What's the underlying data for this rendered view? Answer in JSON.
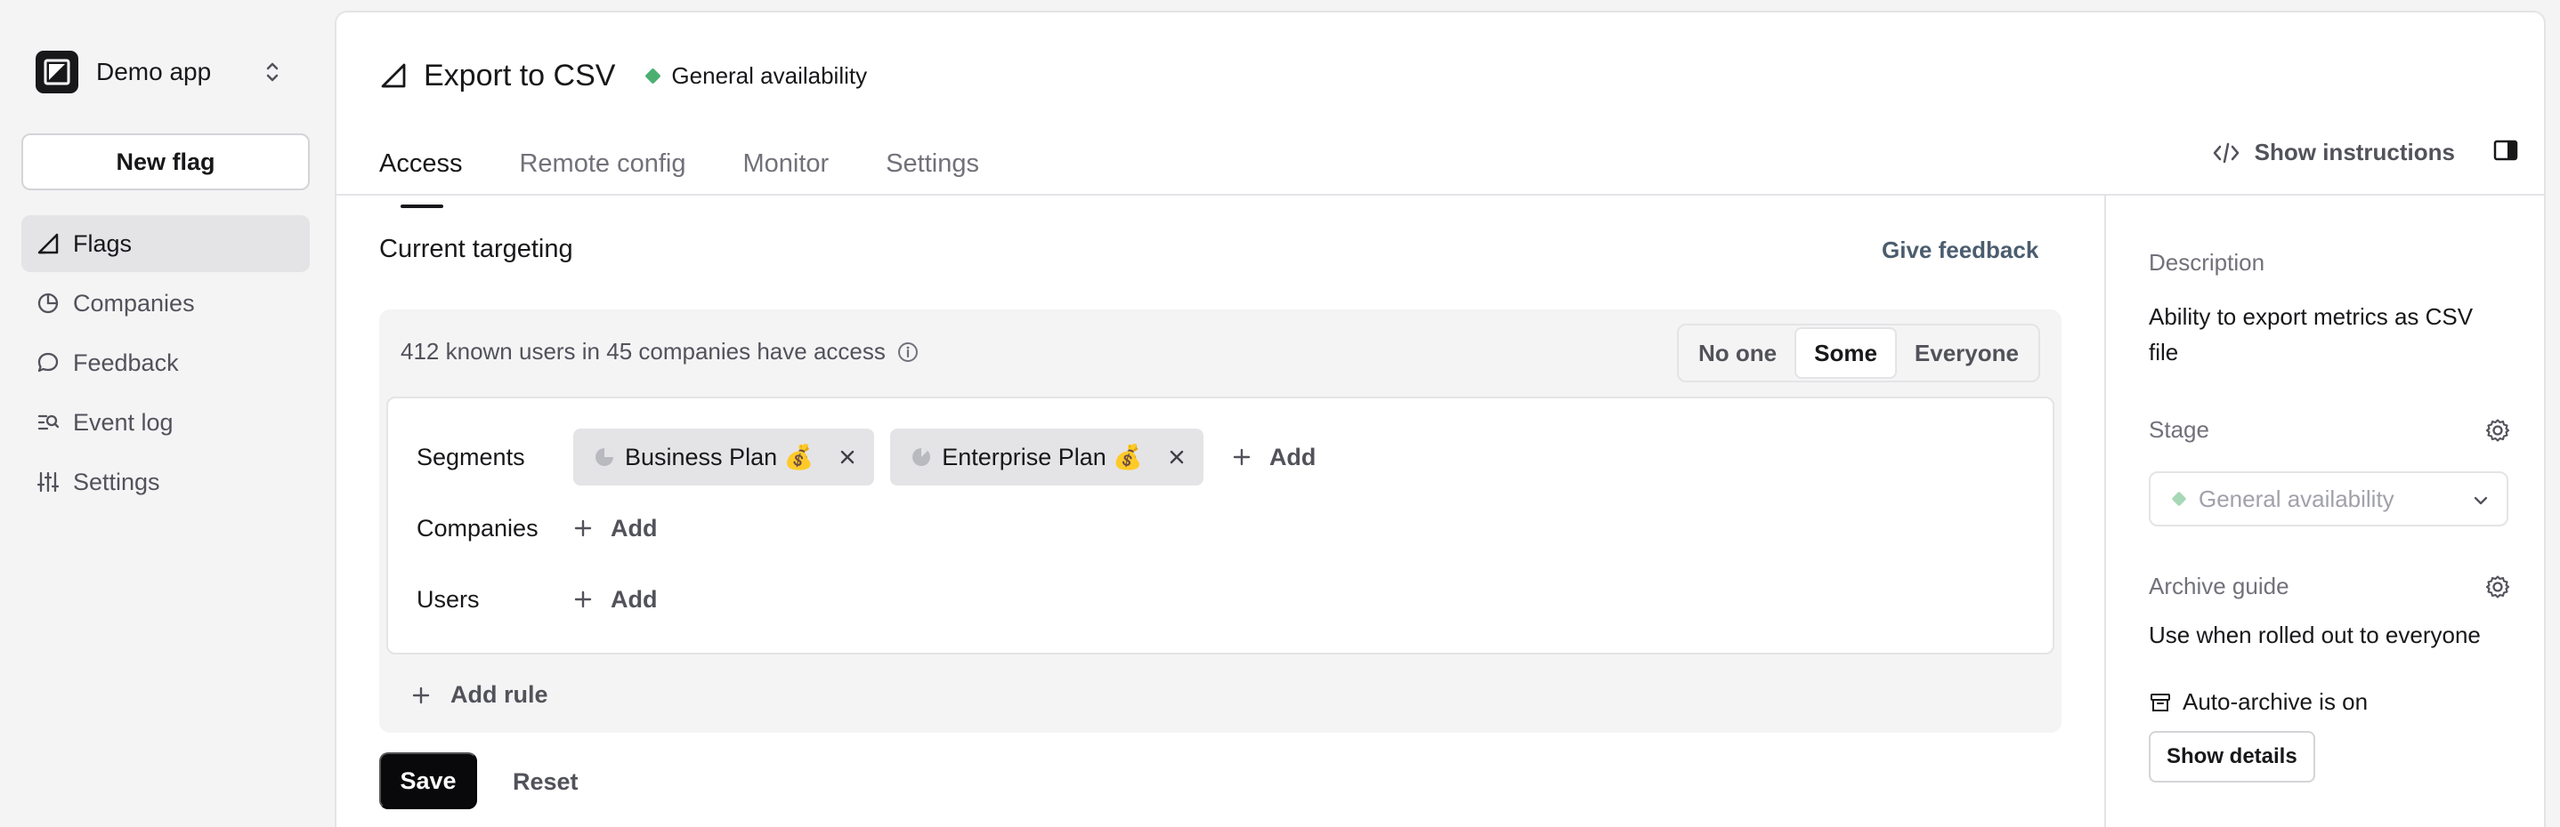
{
  "sidebar": {
    "app_name": "Demo app",
    "new_flag": "New flag",
    "items": [
      {
        "label": "Flags",
        "icon": "flag-icon",
        "active": true
      },
      {
        "label": "Companies",
        "icon": "pie-chart-icon",
        "active": false
      },
      {
        "label": "Feedback",
        "icon": "chat-bubble-icon",
        "active": false
      },
      {
        "label": "Event log",
        "icon": "event-log-icon",
        "active": false
      },
      {
        "label": "Settings",
        "icon": "sliders-icon",
        "active": false
      }
    ]
  },
  "flag": {
    "title": "Export to CSV",
    "stage": "General availability",
    "stage_color": "#4caf72"
  },
  "tabs": [
    {
      "label": "Access",
      "active": true
    },
    {
      "label": "Remote config",
      "active": false
    },
    {
      "label": "Monitor",
      "active": false
    },
    {
      "label": "Settings",
      "active": false
    }
  ],
  "toolbar": {
    "show_instructions": "Show instructions"
  },
  "targeting": {
    "title": "Current targeting",
    "give_feedback": "Give feedback",
    "summary": "412 known users in 45 companies have access",
    "access_options": [
      "No one",
      "Some",
      "Everyone"
    ],
    "access_selected": "Some",
    "rules": {
      "segments_label": "Segments",
      "segments": [
        "Business Plan 💰",
        "Enterprise Plan 💰"
      ],
      "companies_label": "Companies",
      "users_label": "Users",
      "add_label": "Add"
    },
    "add_rule": "Add rule",
    "save": "Save",
    "reset": "Reset"
  },
  "details": {
    "description_label": "Description",
    "description": "Ability to export metrics as CSV file",
    "stage_label": "Stage",
    "stage_value": "General availability",
    "archive_label": "Archive guide",
    "archive_text": "Use when rolled out to everyone",
    "auto_archive": "Auto-archive is on",
    "show_details": "Show details"
  }
}
